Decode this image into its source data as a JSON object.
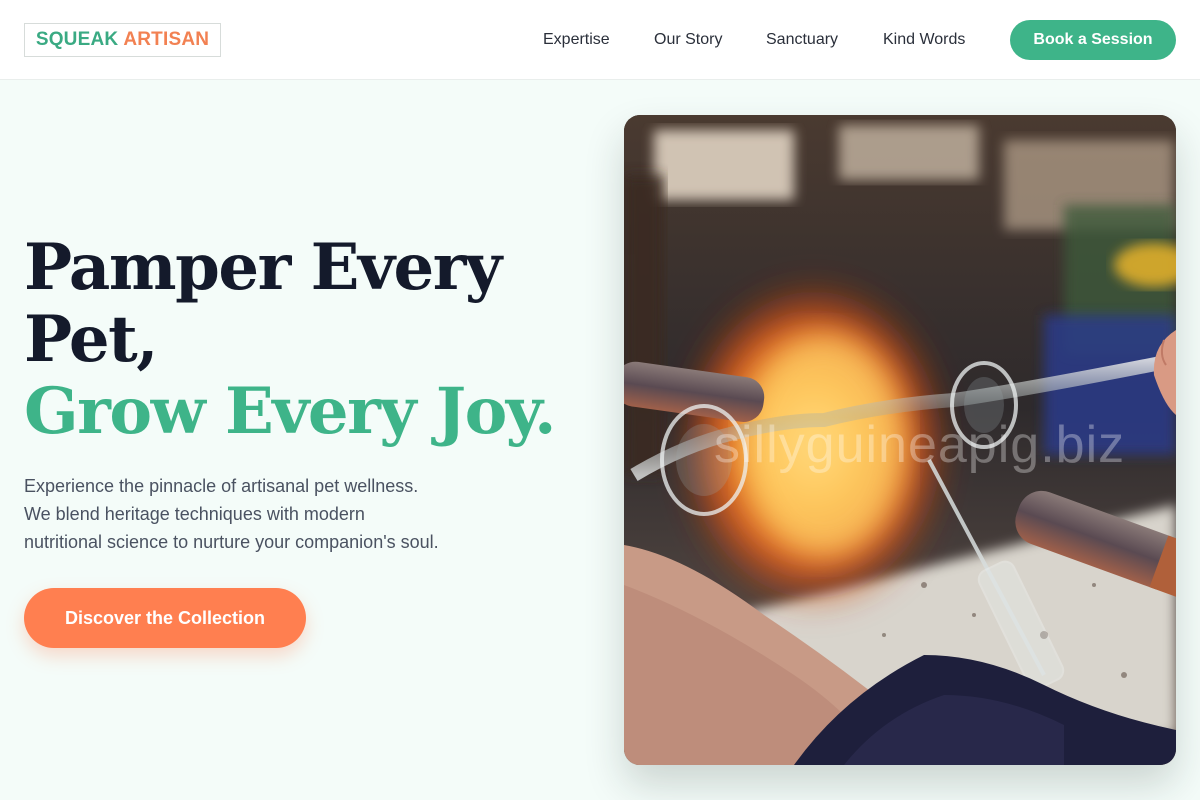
{
  "header": {
    "logo_word1": "SQUEAK",
    "logo_word2": "ARTISAN",
    "nav": [
      "Expertise",
      "Our Story",
      "Sanctuary",
      "Kind Words"
    ],
    "cta_label": "Book a Session"
  },
  "hero": {
    "headline_line1": "Pamper Every",
    "headline_line2": "Pet,",
    "headline_line3": "Grow Every Joy.",
    "intro_line1": "Experience the pinnacle of artisanal pet wellness.",
    "intro_line2": "We blend heritage techniques with modern",
    "intro_line3": "nutritional science to nurture your companion's soul.",
    "cta_label": "Discover the Collection",
    "image_watermark": "sillyguineapig.biz"
  },
  "colors": {
    "brand_green": "#3eb489",
    "brand_orange": "#ff7f50",
    "page_background": "#f4fcf9",
    "headline_dark": "#141a2b"
  },
  "icons": {
    "hero_image": "glassblowing-photo"
  }
}
